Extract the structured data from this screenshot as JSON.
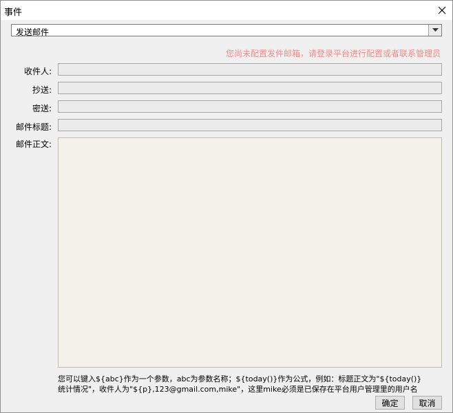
{
  "window": {
    "title": "事件"
  },
  "action_select": {
    "value": "发送邮件"
  },
  "warning_text": "您尚未配置发件邮箱，请登录平台进行配置或者联系管理员",
  "fields": {
    "to_label": "收件人:",
    "cc_label": "抄送:",
    "bcc_label": "密送:",
    "subject_label": "邮件标题:",
    "body_label": "邮件正文:"
  },
  "hint": {
    "line1": "您可以键入${abc}作为一个参数，abc为参数名称；${today()}作为公式，例如：标题正文为\"${today()}",
    "line2": "统计情况\"，收件人为\"${p},123@gmail.com,mike\"，这里mike必须是已保存在平台用户管理里的用户名"
  },
  "buttons": {
    "ok": "确定",
    "cancel": "取消"
  }
}
